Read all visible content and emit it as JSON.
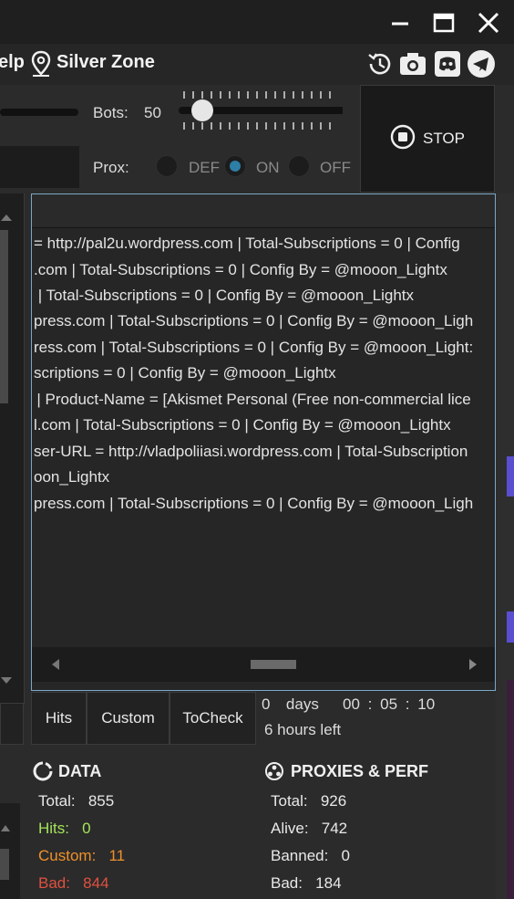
{
  "window": {
    "minimize_icon": "minimize-icon",
    "maximize_icon": "maximize-icon",
    "close_icon": "close-icon"
  },
  "menu": {
    "help_label": "elp",
    "zone_label": "Silver Zone"
  },
  "toolbar": {
    "icons": [
      "history-icon",
      "camera-icon",
      "discord-icon",
      "telegram-icon"
    ]
  },
  "controls": {
    "bots_label": "Bots:",
    "bots_value": "50",
    "bots_level": 50,
    "prox_label": "Prox:",
    "prox_options": [
      "DEF",
      "ON",
      "OFF"
    ],
    "prox_selected": "ON",
    "stop_label": "STOP"
  },
  "log": {
    "lines": [
      "= http://pal2u.wordpress.com | Total-Subscriptions = 0 | Config",
      ".com | Total-Subscriptions = 0 | Config By = @mooon_Lightx",
      " | Total-Subscriptions = 0 | Config By = @mooon_Lightx",
      "press.com | Total-Subscriptions = 0 | Config By = @mooon_Ligh",
      "ress.com | Total-Subscriptions = 0 | Config By = @mooon_Light:",
      "scriptions = 0 | Config By = @mooon_Lightx",
      " | Product-Name = [Akismet Personal (Free non-commercial lice",
      "l.com | Total-Subscriptions = 0 | Config By = @mooon_Lightx",
      "ser-URL = http://vladpoliiasi.wordpress.com | Total-Subscription",
      "oon_Lightx",
      "press.com | Total-Subscriptions = 0 | Config By = @mooon_Ligh"
    ]
  },
  "tabs": [
    "Hits",
    "Custom",
    "ToCheck"
  ],
  "timer": {
    "days": "0",
    "days_label": "days",
    "hours": "00",
    "minutes": "05",
    "seconds": "10",
    "sep": ":",
    "left": "6 hours left"
  },
  "data_section": {
    "title": "DATA",
    "total_label": "Total:",
    "total": "855",
    "hits_label": "Hits:",
    "hits": "0",
    "custom_label": "Custom:",
    "custom": "11",
    "bad_label": "Bad:",
    "bad": "844"
  },
  "proxies_section": {
    "title": "PROXIES & PERF",
    "total_label": "Total:",
    "total": "926",
    "alive_label": "Alive:",
    "alive": "742",
    "banned_label": "Banned:",
    "banned": "0",
    "bad_label": "Bad:",
    "bad": "184"
  },
  "colors": {
    "hits": "#a4e35a",
    "custom": "#f0902a",
    "bad": "#e05040",
    "accent": "#7aa8c8",
    "radio_on": "#2d7fa5",
    "bg_right_purple": "#5a4fcf"
  }
}
